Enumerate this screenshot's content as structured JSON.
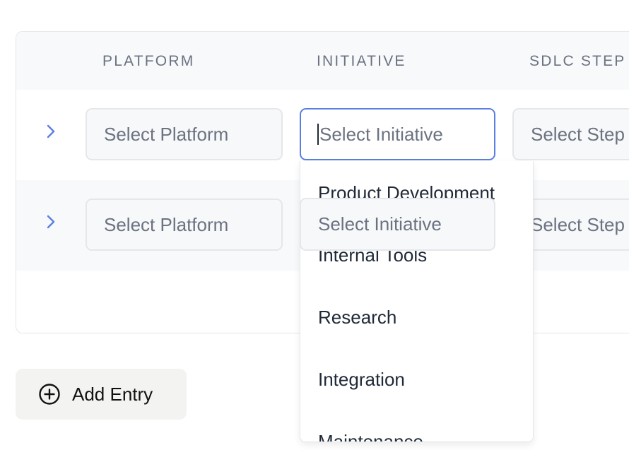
{
  "table": {
    "headers": [
      "PLATFORM",
      "INITIATIVE",
      "SDLC STEP"
    ],
    "rows": [
      {
        "platform_placeholder": "Select Platform",
        "initiative_placeholder": "Select Initiative",
        "step_placeholder": "Select Step"
      },
      {
        "platform_placeholder": "Select Platform",
        "initiative_placeholder": "Select Initiative",
        "step_placeholder": "Select Step"
      }
    ]
  },
  "initiative_dropdown": {
    "options": [
      "Product Development",
      "Internal Tools",
      "Research",
      "Integration",
      "Maintenance"
    ]
  },
  "actions": {
    "add_entry_label": "Add Entry"
  },
  "colors": {
    "accent": "#5b7fe0",
    "header_text": "#6b7280",
    "row_alt_bg": "#f8f9fb"
  },
  "icons": {
    "expand": "chevron-right-icon",
    "add": "plus-circle-icon"
  }
}
